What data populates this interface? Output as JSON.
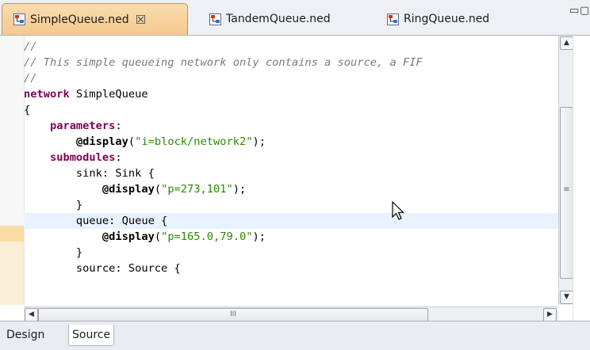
{
  "tabs": [
    {
      "label": "SimpleQueue.ned",
      "close": "☒",
      "active": true
    },
    {
      "label": "TandemQueue.ned",
      "active": false
    },
    {
      "label": "RingQueue.ned",
      "active": false
    }
  ],
  "window_controls": {
    "minimize": "▭",
    "maximize": "▢"
  },
  "code_lines": [
    "//",
    "// This simple queueing network only contains a source, a FIF",
    "//",
    "network SimpleQueue",
    "{",
    "    parameters:",
    "        @display(\"i=block/network2\");",
    "    submodules:",
    "        sink: Sink {",
    "            @display(\"p=273,101\");",
    "        }",
    "        queue: Queue {",
    "            @display(\"p=165.0,79.0\");",
    "        }",
    "        source: Source {"
  ],
  "highlighted_line": 11,
  "scrollbar": {
    "up": "▲",
    "down": "▼",
    "left": "◀",
    "right": "▶",
    "thumb_grip_v": "≡",
    "thumb_grip_h": "III"
  },
  "page_tabs": [
    {
      "label": "Design",
      "active": false
    },
    {
      "label": "Source",
      "active": true
    }
  ],
  "colors": {
    "keyword": "#7f0055",
    "string": "#2a8a00",
    "comment": "#7a7a7a",
    "current_line": "#e8f2fe",
    "active_tab": "#f4c98e"
  }
}
